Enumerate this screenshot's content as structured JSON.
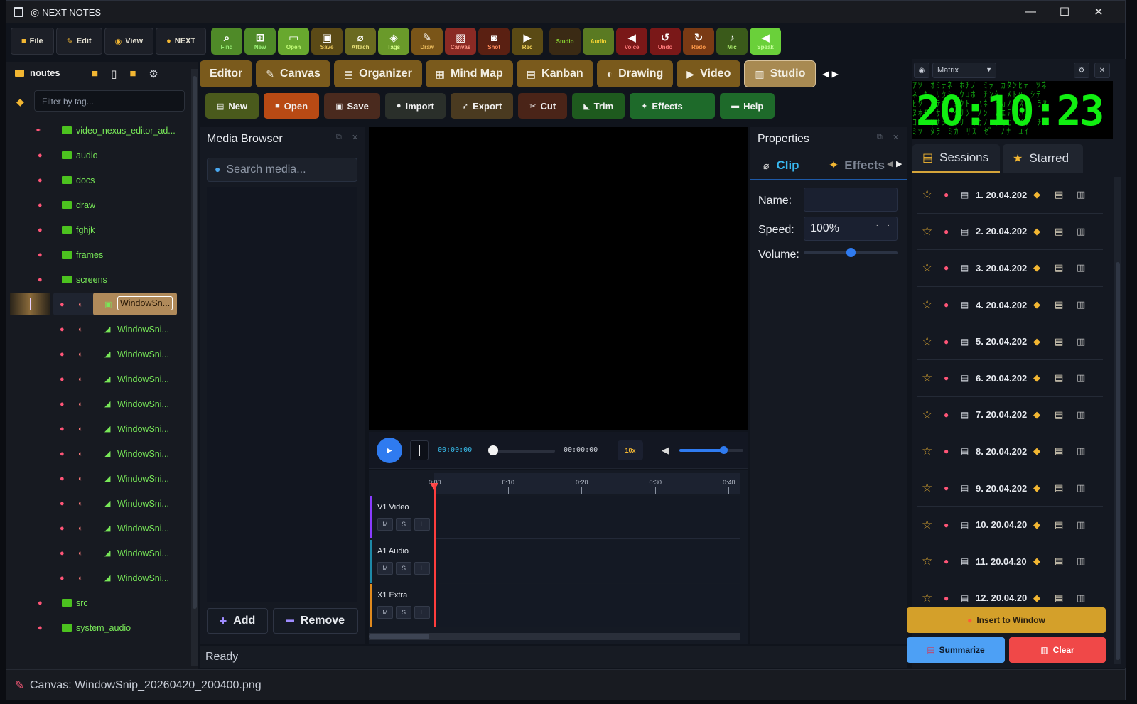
{
  "window": {
    "title": "NEXT NOTES",
    "minimize": "—",
    "maximize": "☐",
    "close": "✕"
  },
  "menu": [
    {
      "icon": "folder-icon",
      "glyph": "■",
      "label": "File"
    },
    {
      "icon": "pencil-icon",
      "glyph": "✎",
      "label": "Edit"
    },
    {
      "icon": "eye-icon",
      "glyph": "◉",
      "label": "View"
    },
    {
      "icon": "bulb-icon",
      "glyph": "●",
      "label": "NEXT"
    }
  ],
  "toolbar": [
    {
      "label": "Find",
      "glyph": "⌕",
      "bg": "#4f8a28",
      "fg": "#9df27a"
    },
    {
      "label": "New",
      "glyph": "⊞",
      "bg": "#4f8a28",
      "fg": "#9df27a"
    },
    {
      "label": "Open",
      "glyph": "▭",
      "bg": "#68a82e",
      "fg": "#c6ff7a"
    },
    {
      "label": "Save",
      "glyph": "▣",
      "bg": "#5b4a16",
      "fg": "#e8c55a"
    },
    {
      "label": "Attach",
      "glyph": "⌀",
      "bg": "#6a6a20",
      "fg": "#e8e07a"
    },
    {
      "label": "Tags",
      "glyph": "◈",
      "bg": "#6a9a2a",
      "fg": "#d8ff8a"
    },
    {
      "label": "Draw",
      "glyph": "✎",
      "bg": "#7a5518",
      "fg": "#f0c060"
    },
    {
      "label": "Canvas",
      "glyph": "▨",
      "bg": "#8a2a24",
      "fg": "#ff9a8a"
    },
    {
      "label": "Shot",
      "glyph": "◙",
      "bg": "#5a2012",
      "fg": "#ff8a5a"
    },
    {
      "label": "Rec",
      "glyph": "▶",
      "bg": "#5a4a14",
      "fg": "#f2d25a"
    },
    {
      "label": "Studio",
      "glyph": "",
      "bg": "#3a2a14",
      "fg": "#88d030"
    },
    {
      "label": "Audio",
      "glyph": "",
      "bg": "#5a7a22",
      "fg": "#f2d232"
    },
    {
      "label": "Voice",
      "glyph": "◀",
      "bg": "#7a1818",
      "fg": "#ff7a7a"
    },
    {
      "label": "Undo",
      "glyph": "↺",
      "bg": "#7a1818",
      "fg": "#ff7a7a"
    },
    {
      "label": "Redo",
      "glyph": "↻",
      "bg": "#7a3a14",
      "fg": "#ff9a4a"
    },
    {
      "label": "Mic",
      "glyph": "♪",
      "bg": "#3a5a1a",
      "fg": "#b0f070"
    },
    {
      "label": "Speak",
      "glyph": "◀",
      "bg": "#6ad03a",
      "fg": "#c6ff9a"
    }
  ],
  "sidebar": {
    "title": "noutes",
    "filter_placeholder": "Filter by tag...",
    "folders": [
      {
        "name": "video_nexus_editor_ad...",
        "pinned": true
      },
      {
        "name": "audio"
      },
      {
        "name": "docs"
      },
      {
        "name": "draw"
      },
      {
        "name": "fghjk"
      },
      {
        "name": "frames"
      },
      {
        "name": "screens"
      }
    ],
    "files": [
      "WindowSn...",
      "WindowSni...",
      "WindowSni...",
      "WindowSni...",
      "WindowSni...",
      "WindowSni...",
      "WindowSni...",
      "WindowSni...",
      "WindowSni...",
      "WindowSni...",
      "WindowSni...",
      "WindowSni..."
    ],
    "folders_bottom": [
      "src",
      "system_audio"
    ]
  },
  "tabs": [
    {
      "label": "Editor",
      "glyph": ""
    },
    {
      "label": "Canvas",
      "glyph": "✎"
    },
    {
      "label": "Organizer",
      "glyph": "▤"
    },
    {
      "label": "Mind Map",
      "glyph": "▦"
    },
    {
      "label": "Kanban",
      "glyph": "▤"
    },
    {
      "label": "Drawing",
      "glyph": "◐"
    },
    {
      "label": "Video",
      "glyph": "▶"
    },
    {
      "label": "Studio",
      "glyph": "▥",
      "active": true
    }
  ],
  "actions": [
    {
      "label": "New",
      "glyph": "▤",
      "bg": "#4a5a1c"
    },
    {
      "label": "Open",
      "glyph": "■",
      "bg": "#b84a14"
    },
    {
      "label": "Save",
      "glyph": "▣",
      "bg": "#4a2a1e"
    },
    {
      "label": "Import",
      "glyph": "●",
      "bg": "#2a2f2a"
    },
    {
      "label": "Export",
      "glyph": "➶",
      "bg": "#4a3a20"
    },
    {
      "label": "Cut",
      "glyph": "✂",
      "bg": "#4a2418"
    },
    {
      "label": "Trim",
      "glyph": "◣",
      "bg": "#1e5a1e"
    },
    {
      "label": "Effects",
      "glyph": "✦",
      "bg": "#1e6a2a"
    },
    {
      "label": "Help",
      "glyph": "▬",
      "bg": "#1e6a2a"
    }
  ],
  "media": {
    "title": "Media Browser",
    "search_placeholder": "Search media...",
    "add": "Add",
    "remove": "Remove"
  },
  "transport": {
    "current": "00:00:00",
    "total": "00:00:00",
    "speed": "10x",
    "volume_level": 0.68
  },
  "timeline": {
    "ticks": [
      "0:00",
      "0:10",
      "0:20",
      "0:30",
      "0:40"
    ],
    "tracks": [
      {
        "name": "V1  Video",
        "color": "#8a3cff"
      },
      {
        "name": "A1  Audio",
        "color": "#1e8aa8"
      },
      {
        "name": "X1  Extra",
        "color": "#e08a1e"
      }
    ],
    "track_buttons": [
      "M",
      "S",
      "L"
    ]
  },
  "properties": {
    "title": "Properties",
    "tab_clip": "Clip",
    "tab_effects": "Effects",
    "name_label": "Name:",
    "name_value": "",
    "speed_label": "Speed:",
    "speed_value": "100%",
    "volume_label": "Volume:",
    "volume_level": 0.5
  },
  "status": {
    "ready": "Ready",
    "canvas": "Canvas: WindowSnip_20260420_200400.png"
  },
  "right": {
    "theme": "Matrix",
    "clock": "20:10:23",
    "tab_sessions": "Sessions",
    "tab_starred": "Starred",
    "sessions": [
      "1. 20.04.202",
      "2. 20.04.202",
      "3. 20.04.202",
      "4. 20.04.202",
      "5. 20.04.202",
      "6. 20.04.202",
      "7. 20.04.202",
      "8. 20.04.202",
      "9. 20.04.202",
      "10. 20.04.20",
      "11. 20.04.20",
      "12. 20.04.20"
    ],
    "insert": "Insert to Window",
    "summarize": "Summarize",
    "clear": "Clear"
  },
  "colors": {
    "accent": "#2f7bf0",
    "gold": "#f2b632",
    "matrix": "#11ee11"
  }
}
